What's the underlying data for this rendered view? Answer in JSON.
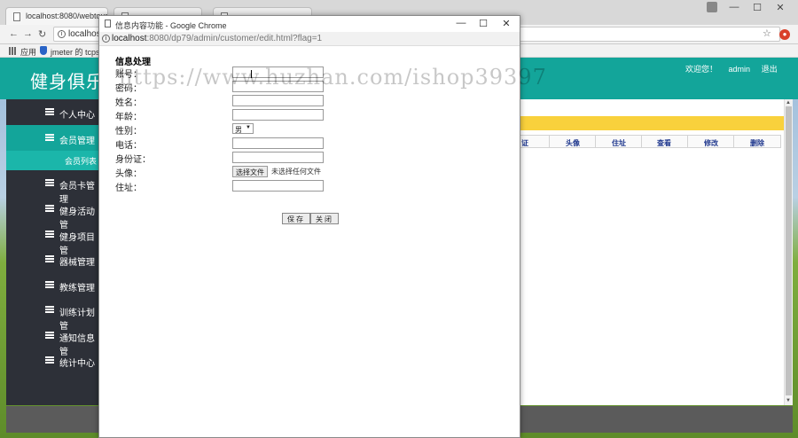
{
  "bg_browser": {
    "tabs": [
      "localhost:8080/webtour",
      "",
      ""
    ],
    "window_controls": [
      "—",
      "☐",
      "✕"
    ],
    "address": "localhost",
    "bookmarks": [
      "应用",
      "jmeter 的 tcpsa"
    ]
  },
  "app": {
    "title": "健身俱乐部",
    "welcome": "欢迎您！",
    "user": "admin",
    "logout": "退出",
    "sidebar": [
      {
        "label": "个人中心"
      },
      {
        "label": "会员管理"
      },
      {
        "label": "会员卡管理"
      },
      {
        "label": "健身活动管"
      },
      {
        "label": "健身项目管"
      },
      {
        "label": "器械管理"
      },
      {
        "label": "教练管理"
      },
      {
        "label": "训练计划管"
      },
      {
        "label": "通知信息管"
      },
      {
        "label": "统计中心"
      }
    ],
    "sidebar_sub": "会员列表",
    "table_headers": [
      "证",
      "头像",
      "住址",
      "查看",
      "修改",
      "删除"
    ]
  },
  "popup": {
    "title": "信息内容功能 - Google Chrome",
    "address_host": "localhost",
    "address_path": ":8080/dp79/admin/customer/edit.html?flag=1",
    "form_title": "信息处理",
    "fields": [
      {
        "label": "账号："
      },
      {
        "label": "密码："
      },
      {
        "label": "姓名："
      },
      {
        "label": "年龄："
      },
      {
        "label": "性别："
      },
      {
        "label": "电话："
      },
      {
        "label": "身份证："
      },
      {
        "label": "头像："
      },
      {
        "label": "住址："
      }
    ],
    "gender_selected": "男",
    "file_button": "选择文件",
    "file_status": "未选择任何文件",
    "save_button": "保存",
    "close_button": "关闭"
  },
  "watermark": "https://www.huzhan.com/ishop39397"
}
